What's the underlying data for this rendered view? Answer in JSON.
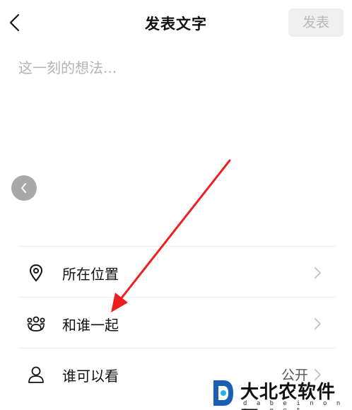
{
  "header": {
    "back_icon": "chevron-left-icon",
    "title": "发表文字",
    "publish_label": "发表"
  },
  "composer": {
    "placeholder": "这一刻的想法...",
    "value": ""
  },
  "floating_back_icon": "chevron-left-icon",
  "options": [
    {
      "icon": "location-pin-icon",
      "label": "所在位置",
      "value": ""
    },
    {
      "icon": "group-icon",
      "label": "和谁一起",
      "value": ""
    },
    {
      "icon": "person-icon",
      "label": "谁可以看",
      "value": "公开"
    }
  ],
  "annotation": {
    "type": "arrow",
    "color": "#f01e1e"
  },
  "watermark": {
    "name": "大北农软件园",
    "url": "d a b e i n o n g . n e t"
  },
  "colors": {
    "publish_bg": "#efefef",
    "publish_text": "#b8b8b8",
    "placeholder": "#b3b3b3",
    "divider": "#ececec"
  }
}
